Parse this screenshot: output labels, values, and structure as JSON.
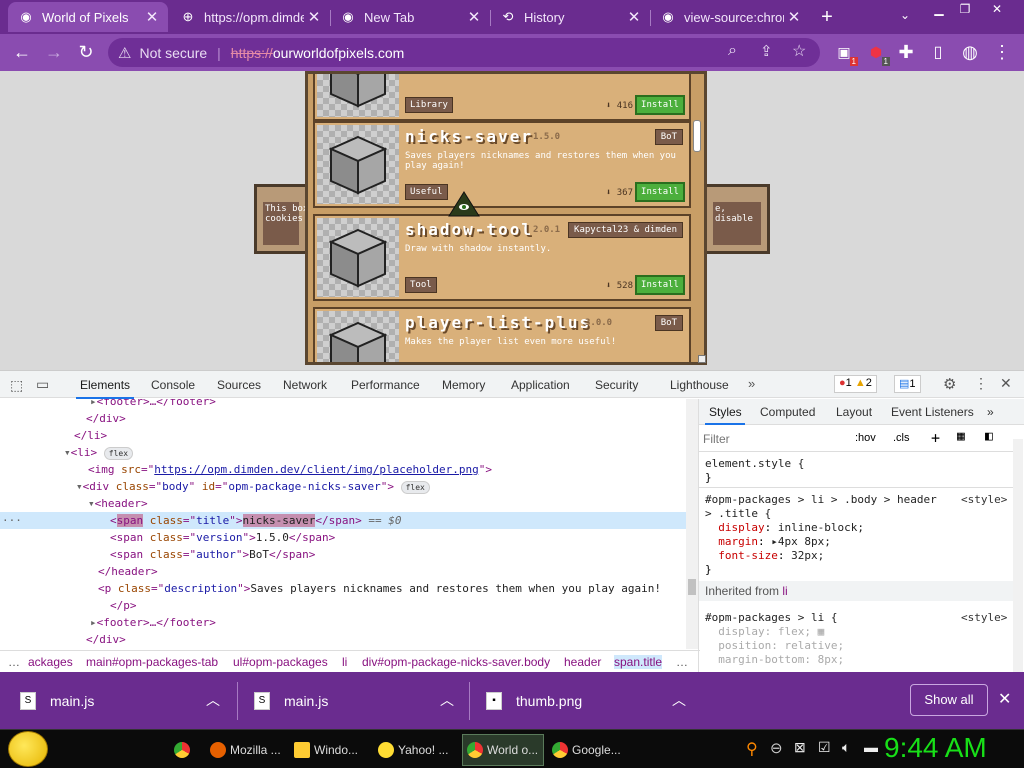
{
  "tabs": [
    {
      "label": "World of Pixels",
      "icon": "globe-icon",
      "active": true
    },
    {
      "label": "https://opm.dimden",
      "icon": "globe-icon"
    },
    {
      "label": "New Tab",
      "icon": "chrome-icon"
    },
    {
      "label": "History",
      "icon": "history-icon"
    },
    {
      "label": "view-source:chrom",
      "icon": "chrome-icon"
    }
  ],
  "toolbar": {
    "security_label": "Not secure",
    "url_scheme": "https://",
    "url_rest": "ourworldofpixels.com",
    "ext_badge_1": "1",
    "ext_badge_2": "1"
  },
  "page": {
    "cookie_left": "This box\ncookies",
    "cookie_right": "e, disable",
    "packages": [
      {
        "title": "",
        "version": "",
        "author": "",
        "description": "",
        "tag": "Library",
        "downloads": "416",
        "install": "Install"
      },
      {
        "title": "nicks-saver",
        "version": "1.5.0",
        "author": "BoT",
        "description": "Saves players nicknames and restores them when you play again!",
        "tag": "Useful",
        "downloads": "367",
        "install": "Install"
      },
      {
        "title": "shadow-tool",
        "version": "2.0.1",
        "author": "Kapyctal23 & dimden",
        "description": "Draw with shadow instantly.",
        "tag": "Tool",
        "downloads": "528",
        "install": "Install"
      },
      {
        "title": "player-list-plus",
        "version": "3.0.0",
        "author": "BoT",
        "description": "Makes the player list even more useful!",
        "tag": "",
        "downloads": "",
        "install": ""
      }
    ]
  },
  "devtools": {
    "tabs": [
      "Elements",
      "Console",
      "Sources",
      "Network",
      "Performance",
      "Memory",
      "Application",
      "Security",
      "Lighthouse"
    ],
    "errors": "1",
    "warnings": "2",
    "messages": "1",
    "breadcrumbs": [
      "ackages",
      "main#opm-packages-tab",
      "ul#opm-packages",
      "li",
      "div#opm-package-nicks-saver.body",
      "header",
      "span.title"
    ],
    "styles_tabs": [
      "Styles",
      "Computed",
      "Layout",
      "Event Listeners"
    ],
    "filter_placeholder": "Filter",
    "hov": ":hov",
    "cls": ".cls",
    "inherited": "Inherited from",
    "inherited_tag": "li"
  },
  "downloads": [
    {
      "name": "main.js",
      "icon": "js-file-icon"
    },
    {
      "name": "main.js",
      "icon": "js-file-icon"
    },
    {
      "name": "thumb.png",
      "icon": "image-file-icon"
    }
  ],
  "show_all": "Show all",
  "taskbar": {
    "items": [
      "Mozilla ...",
      "Windo...",
      "Yahoo! ...",
      "World o...",
      "Google..."
    ],
    "clock": "9:44 AM"
  }
}
